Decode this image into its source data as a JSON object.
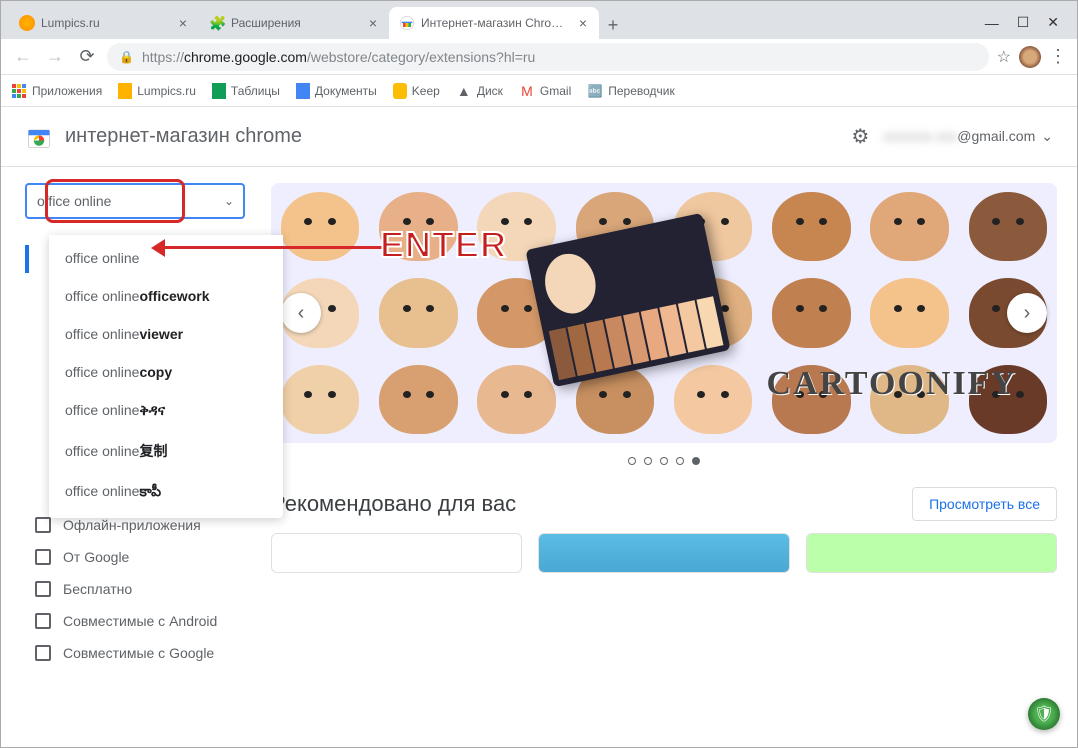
{
  "window": {
    "tabs": [
      {
        "label": "Lumpics.ru",
        "favicon": "orange"
      },
      {
        "label": "Расширения",
        "favicon": "puzzle"
      },
      {
        "label": "Интернет-магазин Chrome - Рас",
        "favicon": "store",
        "active": true
      }
    ]
  },
  "address": {
    "scheme": "https://",
    "host": "chrome.google.com",
    "path": "/webstore/category/extensions?hl=ru"
  },
  "bookmarks": [
    {
      "icon": "apps",
      "label": "Приложения"
    },
    {
      "icon": "yellow-doc",
      "label": "Lumpics.ru"
    },
    {
      "icon": "sheets",
      "label": "Таблицы"
    },
    {
      "icon": "docs",
      "label": "Документы"
    },
    {
      "icon": "keep",
      "label": "Keep"
    },
    {
      "icon": "drive",
      "label": "Диск"
    },
    {
      "icon": "gmail",
      "label": "Gmail"
    },
    {
      "icon": "translate",
      "label": "Переводчик"
    }
  ],
  "store": {
    "title": "интернет-магазин chrome",
    "email_suffix": "@gmail.com"
  },
  "search": {
    "value": "office online",
    "suggestions": [
      {
        "prefix": "office online",
        "suffix": ""
      },
      {
        "prefix": "office online",
        "suffix": "officework"
      },
      {
        "prefix": "office online",
        "suffix": "viewer"
      },
      {
        "prefix": "office online",
        "suffix": "copy"
      },
      {
        "prefix": "office online",
        "suffix": "ቅዳና"
      },
      {
        "prefix": "office online",
        "suffix": "复制"
      },
      {
        "prefix": "office online",
        "suffix": "కాపీ"
      }
    ]
  },
  "filters": [
    "Офлайн-приложения",
    "От Google",
    "Бесплатно",
    "Совместимые с Android",
    "Совместимые с Google"
  ],
  "carousel": {
    "banner_text": "CARTOONIFY",
    "dots_total": 5,
    "dots_active": 4
  },
  "section": {
    "title": "Рекомендовано для вас",
    "viewall": "Просмотреть все"
  },
  "annotation": "ENTER"
}
